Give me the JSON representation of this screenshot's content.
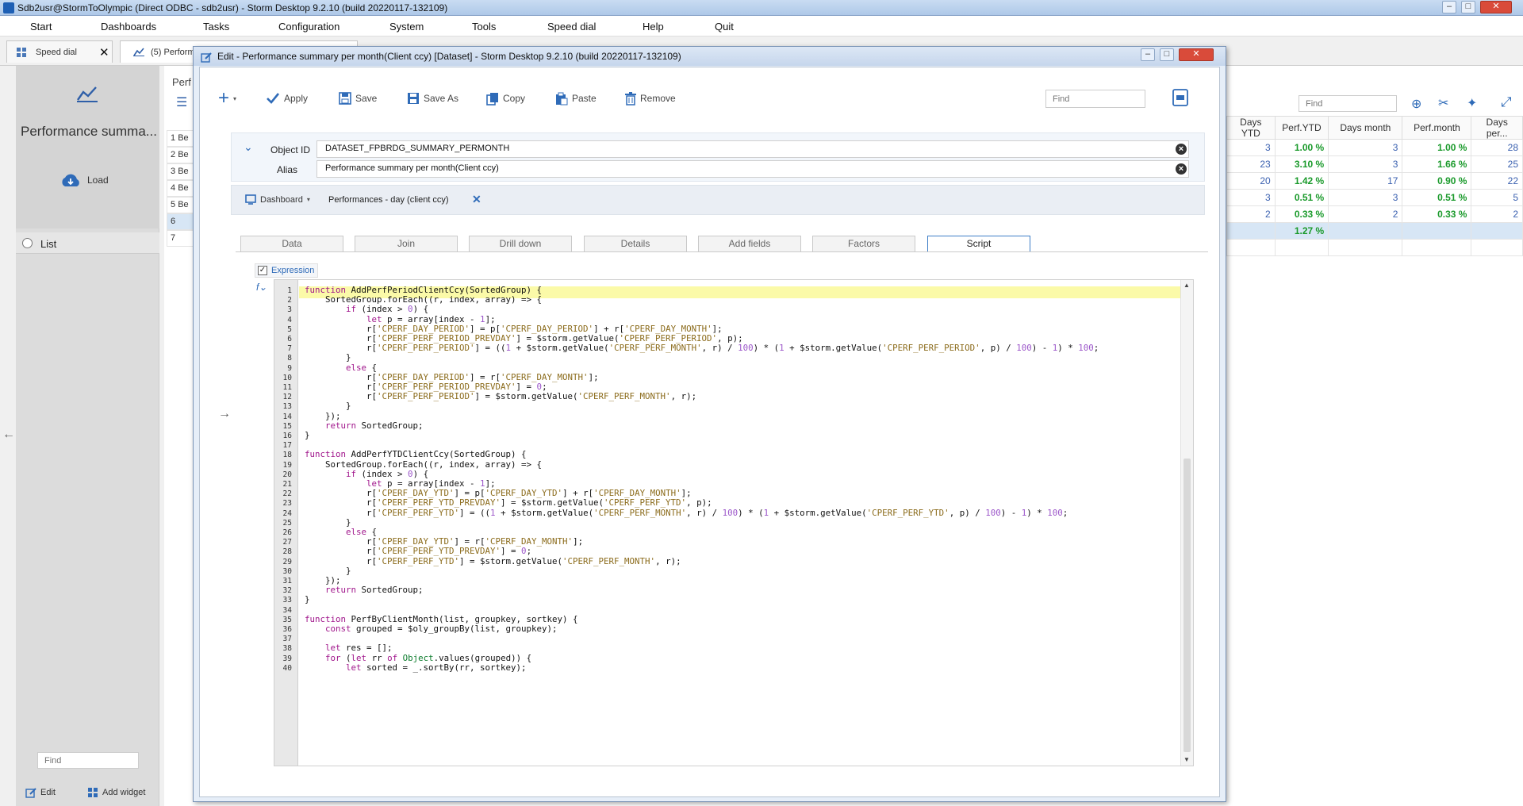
{
  "window": {
    "title": "Sdb2usr@StormToOlympic (Direct ODBC - sdb2usr) -  Storm Desktop 9.2.10 (build 20220117-132109)",
    "controls": [
      "minimize-icon",
      "maximize-icon",
      "close-icon"
    ]
  },
  "menu": [
    "Start",
    "Dashboards",
    "Tasks",
    "Configuration",
    "System",
    "Tools",
    "Speed dial",
    "Help",
    "Quit"
  ],
  "tabs": [
    {
      "label": "Speed dial",
      "close": "✕"
    },
    {
      "label": "(5) Perform"
    }
  ],
  "sidebar": {
    "title": "Performance summa...",
    "load": "Load",
    "list": "List",
    "find_placeholder": "Find",
    "edit": "Edit",
    "add_widget": "Add widget"
  },
  "dashboard": {
    "header_stub": "Perf",
    "find_placeholder": "Find",
    "row_numbers": [
      "1",
      "2",
      "3",
      "4",
      "5",
      "6",
      "7"
    ],
    "row_stubs": [
      "Be",
      "Be",
      "Be",
      "Be",
      "Be",
      "",
      ""
    ],
    "columns": [
      "Days YTD",
      "Perf.YTD",
      "Days month",
      "Perf.month",
      "Days per..."
    ],
    "rows": [
      [
        "3",
        "1.00 %",
        "3",
        "1.00 %",
        "28"
      ],
      [
        "23",
        "3.10 %",
        "3",
        "1.66 %",
        "25"
      ],
      [
        "20",
        "1.42 %",
        "17",
        "0.90 %",
        "22"
      ],
      [
        "3",
        "0.51 %",
        "3",
        "0.51 %",
        "5"
      ],
      [
        "2",
        "0.33 %",
        "2",
        "0.33 %",
        "2"
      ],
      [
        "",
        "1.27 %",
        "",
        "",
        ""
      ],
      [
        "",
        "",
        "",
        "",
        ""
      ]
    ]
  },
  "dialog": {
    "title": "Edit - Performance summary per month(Client ccy) [Dataset] -  Storm Desktop 9.2.10 (build 20220117-132109)",
    "toolbar": {
      "apply": "Apply",
      "save": "Save",
      "save_as": "Save As",
      "copy": "Copy",
      "paste": "Paste",
      "remove": "Remove",
      "find_placeholder": "Find"
    },
    "object_id_label": "Object ID",
    "object_id": "DATASET_FPBRDG_SUMMARY_PERMONTH",
    "alias_label": "Alias",
    "alias": "Performance summary per month(Client ccy)",
    "dashboard_label": "Dashboard",
    "dashboard_chip": "Performances - day (client ccy)",
    "subtabs": [
      "Data",
      "Join",
      "Drill down",
      "Details",
      "Add fields",
      "Factors",
      "Script"
    ],
    "active_subtab": "Script",
    "expression_label": "Expression",
    "code_lines": [
      "function AddPerfPeriodClientCcy(SortedGroup) {",
      "    SortedGroup.forEach((r, index, array) => {",
      "        if (index > 0) {",
      "            let p = array[index - 1];",
      "            r['CPERF_DAY_PERIOD'] = p['CPERF_DAY_PERIOD'] + r['CPERF_DAY_MONTH'];",
      "            r['CPERF_PERF_PERIOD_PREVDAY'] = $storm.getValue('CPERF_PERF_PERIOD', p);",
      "            r['CPERF_PERF_PERIOD'] = ((1 + $storm.getValue('CPERF_PERF_MONTH', r) / 100) * (1 + $storm.getValue('CPERF_PERF_PERIOD', p) / 100) - 1) * 100;",
      "        }",
      "        else {",
      "            r['CPERF_DAY_PERIOD'] = r['CPERF_DAY_MONTH'];",
      "            r['CPERF_PERF_PERIOD_PREVDAY'] = 0;",
      "            r['CPERF_PERF_PERIOD'] = $storm.getValue('CPERF_PERF_MONTH', r);",
      "        }",
      "    });",
      "    return SortedGroup;",
      "}",
      "",
      "function AddPerfYTDClientCcy(SortedGroup) {",
      "    SortedGroup.forEach((r, index, array) => {",
      "        if (index > 0) {",
      "            let p = array[index - 1];",
      "            r['CPERF_DAY_YTD'] = p['CPERF_DAY_YTD'] + r['CPERF_DAY_MONTH'];",
      "            r['CPERF_PERF_YTD_PREVDAY'] = $storm.getValue('CPERF_PERF_YTD', p);",
      "            r['CPERF_PERF_YTD'] = ((1 + $storm.getValue('CPERF_PERF_MONTH', r) / 100) * (1 + $storm.getValue('CPERF_PERF_YTD', p) / 100) - 1) * 100;",
      "        }",
      "        else {",
      "            r['CPERF_DAY_YTD'] = r['CPERF_DAY_MONTH'];",
      "            r['CPERF_PERF_YTD_PREVDAY'] = 0;",
      "            r['CPERF_PERF_YTD'] = $storm.getValue('CPERF_PERF_MONTH', r);",
      "        }",
      "    });",
      "    return SortedGroup;",
      "}",
      "",
      "function PerfByClientMonth(list, groupkey, sortkey) {",
      "    const grouped = $oly_groupBy(list, groupkey);",
      "",
      "    let res = [];",
      "    for (let rr of Object.values(grouped)) {",
      "        let sorted = _.sortBy(rr, sortkey);"
    ]
  }
}
